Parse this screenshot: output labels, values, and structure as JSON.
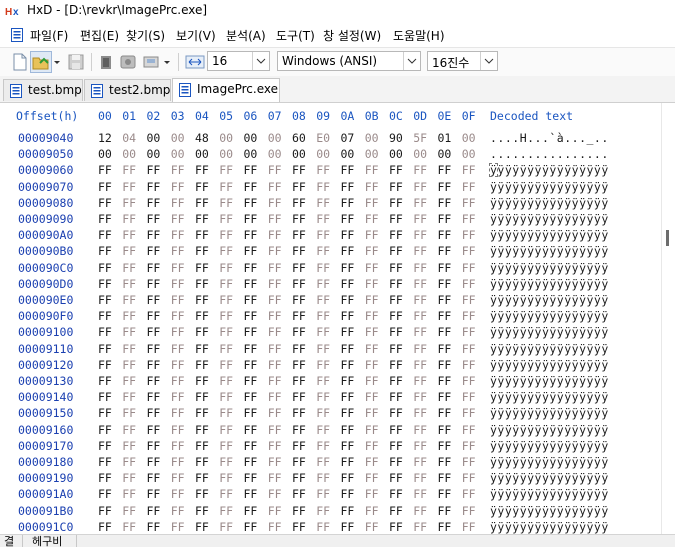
{
  "window": {
    "title": "HxD - [D:\\revkr\\ImagePrc.exe]",
    "app_icon": "hxd-app-icon"
  },
  "menu": [
    {
      "label": "파일(F)"
    },
    {
      "label": "편집(E)"
    },
    {
      "label": "찾기(S)"
    },
    {
      "label": "보기(V)"
    },
    {
      "label": "분석(A)"
    },
    {
      "label": "도구(T)"
    },
    {
      "label": "창 설정(W)"
    },
    {
      "label": "도움말(H)"
    }
  ],
  "toolbar": {
    "icons": [
      "new-file-icon",
      "open-file-icon",
      "dropdown-arrow-icon",
      "save-icon",
      "memory-icon",
      "disk-icon",
      "drive-icon",
      "dropdown-arrow-icon"
    ],
    "columns_icon": "columns-width-icon",
    "bytes_per_row": "16",
    "charset": "Windows (ANSI)",
    "offset_base": "16진수"
  },
  "tabs": [
    {
      "label": "test.bmp",
      "active": false
    },
    {
      "label": "test2.bmp",
      "active": false
    },
    {
      "label": "ImagePrc.exe",
      "active": true
    }
  ],
  "hex_view": {
    "offset_header": "Offset(h)",
    "column_headers": [
      "00",
      "01",
      "02",
      "03",
      "04",
      "05",
      "06",
      "07",
      "08",
      "09",
      "0A",
      "0B",
      "0C",
      "0D",
      "0E",
      "0F"
    ],
    "decoded_header": "Decoded text",
    "rows": [
      {
        "offset": "00009040",
        "bytes": [
          "12",
          "04",
          "00",
          "00",
          "48",
          "00",
          "00",
          "00",
          "60",
          "E0",
          "07",
          "00",
          "90",
          "5F",
          "01",
          "00"
        ],
        "text": "....H...`à..._.."
      },
      {
        "offset": "00009050",
        "bytes": [
          "00",
          "00",
          "00",
          "00",
          "00",
          "00",
          "00",
          "00",
          "00",
          "00",
          "00",
          "00",
          "00",
          "00",
          "00",
          "00"
        ],
        "text": "................"
      },
      {
        "offset": "00009060",
        "bytes": [
          "FF",
          "FF",
          "FF",
          "FF",
          "FF",
          "FF",
          "FF",
          "FF",
          "FF",
          "FF",
          "FF",
          "FF",
          "FF",
          "FF",
          "FF",
          "FF"
        ],
        "text": "ÿÿÿÿÿÿÿÿÿÿÿÿÿÿÿÿ"
      },
      {
        "offset": "00009070",
        "bytes": [
          "FF",
          "FF",
          "FF",
          "FF",
          "FF",
          "FF",
          "FF",
          "FF",
          "FF",
          "FF",
          "FF",
          "FF",
          "FF",
          "FF",
          "FF",
          "FF"
        ],
        "text": "ÿÿÿÿÿÿÿÿÿÿÿÿÿÿÿÿ"
      },
      {
        "offset": "00009080",
        "bytes": [
          "FF",
          "FF",
          "FF",
          "FF",
          "FF",
          "FF",
          "FF",
          "FF",
          "FF",
          "FF",
          "FF",
          "FF",
          "FF",
          "FF",
          "FF",
          "FF"
        ],
        "text": "ÿÿÿÿÿÿÿÿÿÿÿÿÿÿÿÿ"
      },
      {
        "offset": "00009090",
        "bytes": [
          "FF",
          "FF",
          "FF",
          "FF",
          "FF",
          "FF",
          "FF",
          "FF",
          "FF",
          "FF",
          "FF",
          "FF",
          "FF",
          "FF",
          "FF",
          "FF"
        ],
        "text": "ÿÿÿÿÿÿÿÿÿÿÿÿÿÿÿÿ"
      },
      {
        "offset": "000090A0",
        "bytes": [
          "FF",
          "FF",
          "FF",
          "FF",
          "FF",
          "FF",
          "FF",
          "FF",
          "FF",
          "FF",
          "FF",
          "FF",
          "FF",
          "FF",
          "FF",
          "FF"
        ],
        "text": "ÿÿÿÿÿÿÿÿÿÿÿÿÿÿÿÿ"
      },
      {
        "offset": "000090B0",
        "bytes": [
          "FF",
          "FF",
          "FF",
          "FF",
          "FF",
          "FF",
          "FF",
          "FF",
          "FF",
          "FF",
          "FF",
          "FF",
          "FF",
          "FF",
          "FF",
          "FF"
        ],
        "text": "ÿÿÿÿÿÿÿÿÿÿÿÿÿÿÿÿ"
      },
      {
        "offset": "000090C0",
        "bytes": [
          "FF",
          "FF",
          "FF",
          "FF",
          "FF",
          "FF",
          "FF",
          "FF",
          "FF",
          "FF",
          "FF",
          "FF",
          "FF",
          "FF",
          "FF",
          "FF"
        ],
        "text": "ÿÿÿÿÿÿÿÿÿÿÿÿÿÿÿÿ"
      },
      {
        "offset": "000090D0",
        "bytes": [
          "FF",
          "FF",
          "FF",
          "FF",
          "FF",
          "FF",
          "FF",
          "FF",
          "FF",
          "FF",
          "FF",
          "FF",
          "FF",
          "FF",
          "FF",
          "FF"
        ],
        "text": "ÿÿÿÿÿÿÿÿÿÿÿÿÿÿÿÿ"
      },
      {
        "offset": "000090E0",
        "bytes": [
          "FF",
          "FF",
          "FF",
          "FF",
          "FF",
          "FF",
          "FF",
          "FF",
          "FF",
          "FF",
          "FF",
          "FF",
          "FF",
          "FF",
          "FF",
          "FF"
        ],
        "text": "ÿÿÿÿÿÿÿÿÿÿÿÿÿÿÿÿ"
      },
      {
        "offset": "000090F0",
        "bytes": [
          "FF",
          "FF",
          "FF",
          "FF",
          "FF",
          "FF",
          "FF",
          "FF",
          "FF",
          "FF",
          "FF",
          "FF",
          "FF",
          "FF",
          "FF",
          "FF"
        ],
        "text": "ÿÿÿÿÿÿÿÿÿÿÿÿÿÿÿÿ"
      },
      {
        "offset": "00009100",
        "bytes": [
          "FF",
          "FF",
          "FF",
          "FF",
          "FF",
          "FF",
          "FF",
          "FF",
          "FF",
          "FF",
          "FF",
          "FF",
          "FF",
          "FF",
          "FF",
          "FF"
        ],
        "text": "ÿÿÿÿÿÿÿÿÿÿÿÿÿÿÿÿ"
      },
      {
        "offset": "00009110",
        "bytes": [
          "FF",
          "FF",
          "FF",
          "FF",
          "FF",
          "FF",
          "FF",
          "FF",
          "FF",
          "FF",
          "FF",
          "FF",
          "FF",
          "FF",
          "FF",
          "FF"
        ],
        "text": "ÿÿÿÿÿÿÿÿÿÿÿÿÿÿÿÿ"
      },
      {
        "offset": "00009120",
        "bytes": [
          "FF",
          "FF",
          "FF",
          "FF",
          "FF",
          "FF",
          "FF",
          "FF",
          "FF",
          "FF",
          "FF",
          "FF",
          "FF",
          "FF",
          "FF",
          "FF"
        ],
        "text": "ÿÿÿÿÿÿÿÿÿÿÿÿÿÿÿÿ"
      },
      {
        "offset": "00009130",
        "bytes": [
          "FF",
          "FF",
          "FF",
          "FF",
          "FF",
          "FF",
          "FF",
          "FF",
          "FF",
          "FF",
          "FF",
          "FF",
          "FF",
          "FF",
          "FF",
          "FF"
        ],
        "text": "ÿÿÿÿÿÿÿÿÿÿÿÿÿÿÿÿ"
      },
      {
        "offset": "00009140",
        "bytes": [
          "FF",
          "FF",
          "FF",
          "FF",
          "FF",
          "FF",
          "FF",
          "FF",
          "FF",
          "FF",
          "FF",
          "FF",
          "FF",
          "FF",
          "FF",
          "FF"
        ],
        "text": "ÿÿÿÿÿÿÿÿÿÿÿÿÿÿÿÿ"
      },
      {
        "offset": "00009150",
        "bytes": [
          "FF",
          "FF",
          "FF",
          "FF",
          "FF",
          "FF",
          "FF",
          "FF",
          "FF",
          "FF",
          "FF",
          "FF",
          "FF",
          "FF",
          "FF",
          "FF"
        ],
        "text": "ÿÿÿÿÿÿÿÿÿÿÿÿÿÿÿÿ"
      },
      {
        "offset": "00009160",
        "bytes": [
          "FF",
          "FF",
          "FF",
          "FF",
          "FF",
          "FF",
          "FF",
          "FF",
          "FF",
          "FF",
          "FF",
          "FF",
          "FF",
          "FF",
          "FF",
          "FF"
        ],
        "text": "ÿÿÿÿÿÿÿÿÿÿÿÿÿÿÿÿ"
      },
      {
        "offset": "00009170",
        "bytes": [
          "FF",
          "FF",
          "FF",
          "FF",
          "FF",
          "FF",
          "FF",
          "FF",
          "FF",
          "FF",
          "FF",
          "FF",
          "FF",
          "FF",
          "FF",
          "FF"
        ],
        "text": "ÿÿÿÿÿÿÿÿÿÿÿÿÿÿÿÿ"
      },
      {
        "offset": "00009180",
        "bytes": [
          "FF",
          "FF",
          "FF",
          "FF",
          "FF",
          "FF",
          "FF",
          "FF",
          "FF",
          "FF",
          "FF",
          "FF",
          "FF",
          "FF",
          "FF",
          "FF"
        ],
        "text": "ÿÿÿÿÿÿÿÿÿÿÿÿÿÿÿÿ"
      },
      {
        "offset": "00009190",
        "bytes": [
          "FF",
          "FF",
          "FF",
          "FF",
          "FF",
          "FF",
          "FF",
          "FF",
          "FF",
          "FF",
          "FF",
          "FF",
          "FF",
          "FF",
          "FF",
          "FF"
        ],
        "text": "ÿÿÿÿÿÿÿÿÿÿÿÿÿÿÿÿ"
      },
      {
        "offset": "000091A0",
        "bytes": [
          "FF",
          "FF",
          "FF",
          "FF",
          "FF",
          "FF",
          "FF",
          "FF",
          "FF",
          "FF",
          "FF",
          "FF",
          "FF",
          "FF",
          "FF",
          "FF"
        ],
        "text": "ÿÿÿÿÿÿÿÿÿÿÿÿÿÿÿÿ"
      },
      {
        "offset": "000091B0",
        "bytes": [
          "FF",
          "FF",
          "FF",
          "FF",
          "FF",
          "FF",
          "FF",
          "FF",
          "FF",
          "FF",
          "FF",
          "FF",
          "FF",
          "FF",
          "FF",
          "FF"
        ],
        "text": "ÿÿÿÿÿÿÿÿÿÿÿÿÿÿÿÿ"
      },
      {
        "offset": "000091C0",
        "bytes": [
          "FF",
          "FF",
          "FF",
          "FF",
          "FF",
          "FF",
          "FF",
          "FF",
          "FF",
          "FF",
          "FF",
          "FF",
          "FF",
          "FF",
          "FF",
          "FF"
        ],
        "text": "ÿÿÿÿÿÿÿÿÿÿÿÿÿÿÿÿ"
      }
    ]
  },
  "status": {
    "left_label": "결",
    "right_label": "헤구비"
  }
}
